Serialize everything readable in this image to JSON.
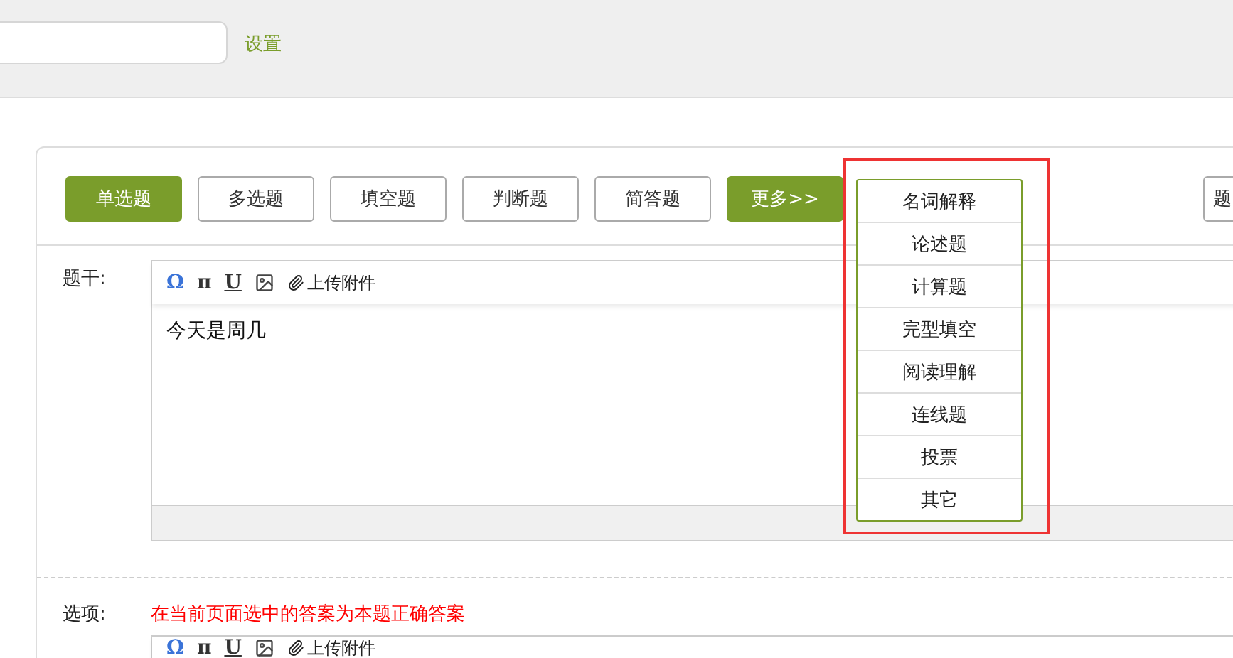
{
  "header": {
    "settings_link": "设置"
  },
  "question_types": [
    {
      "label": "单选题",
      "selected": true
    },
    {
      "label": "多选题",
      "selected": false
    },
    {
      "label": "填空题",
      "selected": false
    },
    {
      "label": "判断题",
      "selected": false
    },
    {
      "label": "简答题",
      "selected": false
    }
  ],
  "more_button": {
    "label": "更多>>",
    "expanded": true
  },
  "more_menu": {
    "items": [
      "名词解释",
      "论述题",
      "计算题",
      "完型填空",
      "阅读理解",
      "连线题",
      "投票",
      "其它"
    ]
  },
  "right_button": "题",
  "stem": {
    "label": "题干:",
    "toolbar": [
      {
        "kind": "omega",
        "label": "Ω"
      },
      {
        "kind": "pi",
        "label": "π"
      },
      {
        "kind": "underline",
        "label": "U"
      },
      {
        "kind": "image"
      },
      {
        "kind": "attach",
        "label": "上传附件"
      }
    ],
    "content": "今天是周几"
  },
  "options": {
    "label": "选项:",
    "hint": "在当前页面选中的答案为本题正确答案",
    "toolbar": [
      {
        "kind": "omega",
        "label": "Ω"
      },
      {
        "kind": "pi",
        "label": "π"
      },
      {
        "kind": "underline",
        "label": "U"
      },
      {
        "kind": "image"
      },
      {
        "kind": "attach",
        "label": "上传附件"
      }
    ]
  }
}
